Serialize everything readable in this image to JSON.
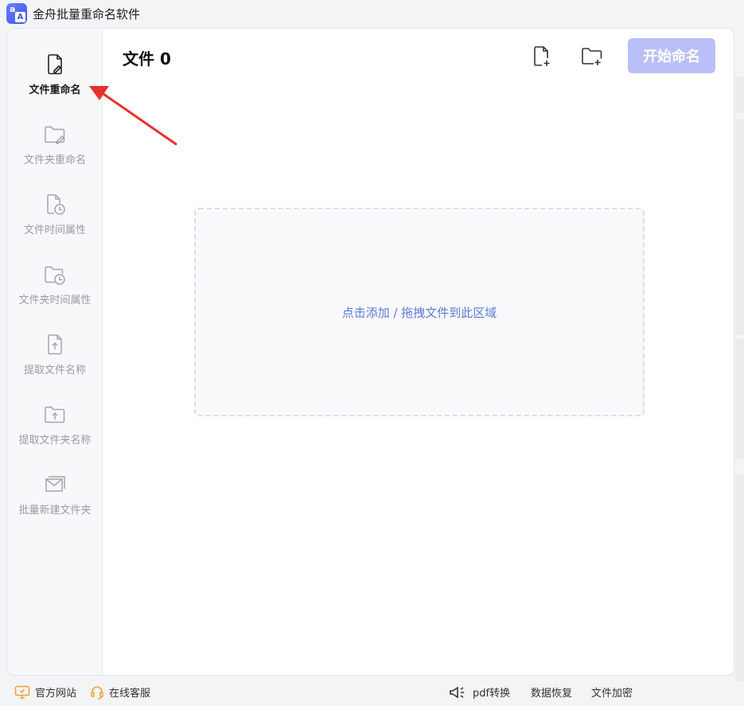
{
  "app": {
    "title": "金舟批量重命名软件",
    "logo_small": "a",
    "logo_large": "A"
  },
  "sidebar": {
    "items": [
      {
        "label": "文件重命名",
        "icon": "file-edit-icon",
        "active": true
      },
      {
        "label": "文件夹重命名",
        "icon": "folder-edit-icon",
        "active": false
      },
      {
        "label": "文件时间属性",
        "icon": "file-clock-icon",
        "active": false
      },
      {
        "label": "文件夹时间属性",
        "icon": "folder-clock-icon",
        "active": false
      },
      {
        "label": "提取文件名称",
        "icon": "file-upload-icon",
        "active": false
      },
      {
        "label": "提取文件夹名称",
        "icon": "folder-upload-icon",
        "active": false
      },
      {
        "label": "批量新建文件夹",
        "icon": "folder-stack-icon",
        "active": false
      }
    ]
  },
  "main": {
    "title": "文件 0",
    "start_button": "开始命名",
    "dropzone_text": "点击添加 / 拖拽文件到此区域"
  },
  "footer": {
    "website": "官方网站",
    "support": "在线客服",
    "pdf": "pdf转换",
    "recovery": "数据恢复",
    "encrypt": "文件加密"
  },
  "colors": {
    "accent": "#b9c0f7",
    "link": "#5b7bd5",
    "annotation": "#e8322b"
  }
}
